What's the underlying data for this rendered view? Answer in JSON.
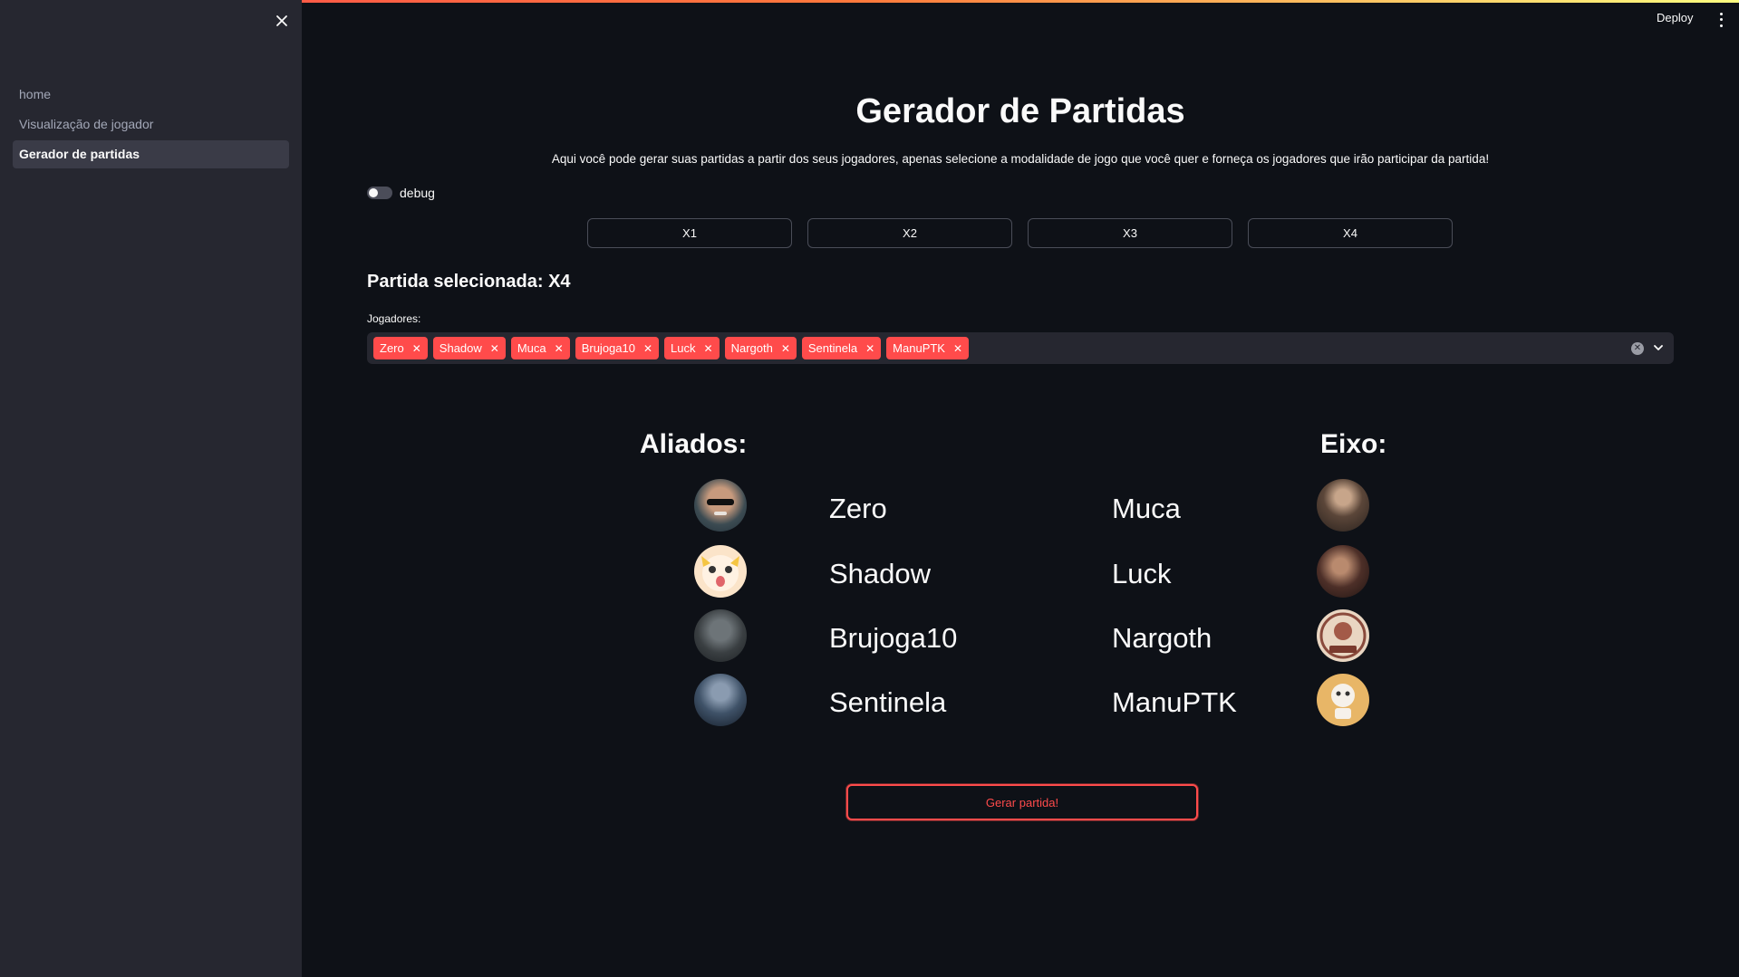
{
  "header": {
    "deploy_label": "Deploy"
  },
  "sidebar": {
    "items": [
      {
        "label": "home"
      },
      {
        "label": "Visualização de jogador"
      },
      {
        "label": "Gerador de partidas"
      }
    ]
  },
  "main": {
    "title": "Gerador de Partidas",
    "subtitle": "Aqui você pode gerar suas partidas a partir dos seus jogadores, apenas selecione a modalidade de jogo que você quer e forneça os jogadores que irão participar da partida!",
    "debug_label": "debug",
    "modes": [
      "X1",
      "X2",
      "X3",
      "X4"
    ],
    "selected_label": "Partida selecionada: X4",
    "jogadores_label": "Jogadores:",
    "selected_players": [
      "Zero",
      "Shadow",
      "Muca",
      "Brujoga10",
      "Luck",
      "Nargoth",
      "Sentinela",
      "ManuPTK"
    ],
    "teams": {
      "aliados": {
        "title": "Aliados:",
        "players": [
          "Zero",
          "Shadow",
          "Brujoga10",
          "Sentinela"
        ]
      },
      "eixo": {
        "title": "Eixo:",
        "players": [
          "Muca",
          "Luck",
          "Nargoth",
          "ManuPTK"
        ]
      }
    },
    "gerar_button": "Gerar partida!"
  },
  "colors": {
    "accent": "#ff4b4b",
    "background": "#0e1117",
    "sidebar": "#262730"
  }
}
